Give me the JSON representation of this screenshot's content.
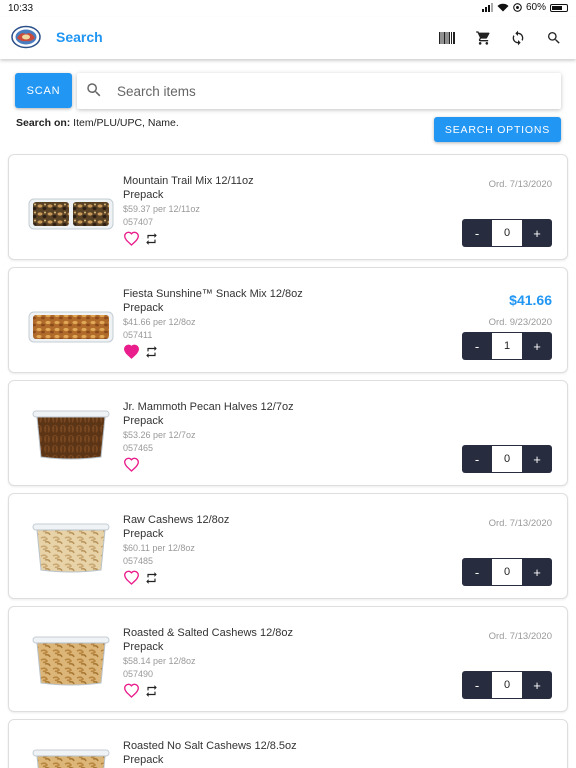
{
  "status": {
    "time": "10:33",
    "battery": "60%"
  },
  "header": {
    "title": "Search",
    "logo": "brand-logo",
    "actions": [
      "barcode-icon",
      "cart-icon",
      "sync-icon",
      "search-icon"
    ]
  },
  "search": {
    "scan_label": "SCAN",
    "placeholder": "Search items",
    "value": "",
    "search_on_label": "Search on:",
    "search_on_fields": " Item/PLU/UPC, Name.",
    "options_label": "SEARCH OPTIONS"
  },
  "colors": {
    "accent": "#2196f3",
    "stepper": "#272c3f",
    "heart": "#e91e8c"
  },
  "items": [
    {
      "name": "Mountain Trail Mix 12/11oz",
      "pack": "Prepack",
      "unit_price": "$59.37 per 12/11oz",
      "code": "057407",
      "price": "",
      "ord": "Ord. 7/13/2020",
      "qty": "0",
      "favorite": false,
      "reorder": true,
      "image": "trail-mix-tray"
    },
    {
      "name": "Fiesta Sunshine™ Snack Mix 12/8oz",
      "pack": "Prepack",
      "unit_price": "$41.66 per 12/8oz",
      "code": "057411",
      "price": "$41.66",
      "ord": "Ord. 9/23/2020",
      "qty": "1",
      "favorite": true,
      "reorder": true,
      "image": "snack-mix-tray"
    },
    {
      "name": "Jr. Mammoth Pecan Halves 12/7oz",
      "pack": "Prepack",
      "unit_price": "$53.26 per 12/7oz",
      "code": "057465",
      "price": "",
      "ord": "",
      "qty": "0",
      "favorite": false,
      "reorder": false,
      "image": "pecan-tub"
    },
    {
      "name": "Raw Cashews 12/8oz",
      "pack": "Prepack",
      "unit_price": "$60.11 per 12/8oz",
      "code": "057485",
      "price": "",
      "ord": "Ord. 7/13/2020",
      "qty": "0",
      "favorite": false,
      "reorder": true,
      "image": "cashew-tub"
    },
    {
      "name": "Roasted & Salted Cashews 12/8oz",
      "pack": "Prepack",
      "unit_price": "$58.14 per 12/8oz",
      "code": "057490",
      "price": "",
      "ord": "Ord. 7/13/2020",
      "qty": "0",
      "favorite": false,
      "reorder": true,
      "image": "cashew-tub"
    },
    {
      "name": "Roasted No Salt Cashews 12/8.5oz",
      "pack": "Prepack",
      "unit_price": "",
      "code": "",
      "price": "",
      "ord": "",
      "qty": "",
      "favorite": false,
      "reorder": false,
      "image": "cashew-tub"
    }
  ]
}
